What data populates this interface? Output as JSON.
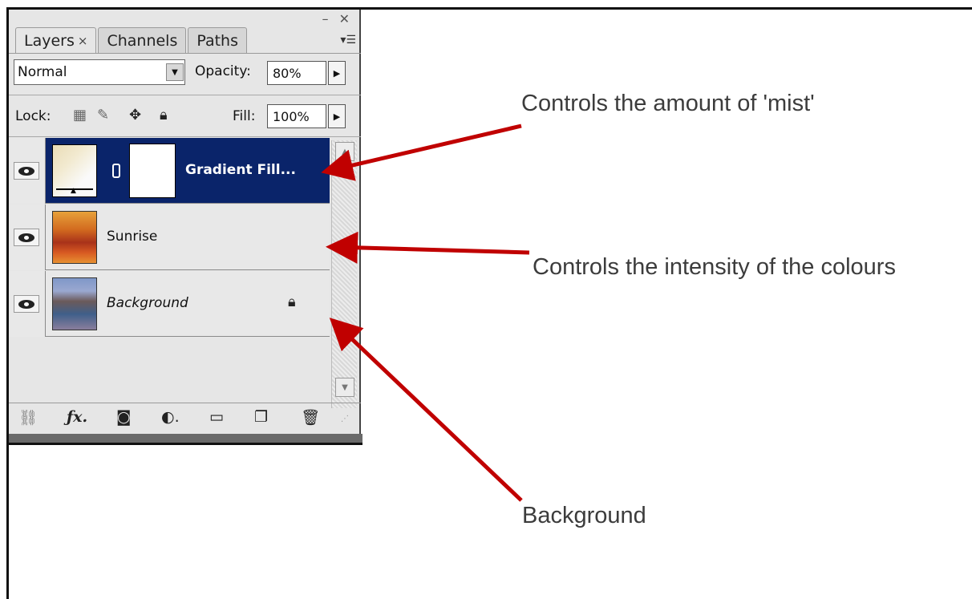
{
  "panel": {
    "window_controls": "– ✕",
    "menu_glyph": "▾☰",
    "tabs": [
      {
        "label": "Layers",
        "close": "×"
      },
      {
        "label": "Channels"
      },
      {
        "label": "Paths"
      }
    ],
    "blend_mode": "Normal",
    "opacity_label": "Opacity:",
    "opacity_value": "80%",
    "lock_label": "Lock:",
    "fill_label": "Fill:",
    "fill_value": "100%",
    "layers": [
      {
        "name": "Gradient Fill...",
        "selected": true
      },
      {
        "name": "Sunrise",
        "selected": false
      },
      {
        "name": "Background",
        "selected": false,
        "locked": true
      }
    ],
    "bottom_tools": [
      "link-layers",
      "fx",
      "mask",
      "adjustment",
      "group",
      "new-layer",
      "delete"
    ]
  },
  "annotations": {
    "mist": "Controls the amount of 'mist'",
    "colours": "Controls the intensity of the colours",
    "background": "Background"
  },
  "colors": {
    "arrow": "#c00000",
    "selection": "#0a246a"
  }
}
